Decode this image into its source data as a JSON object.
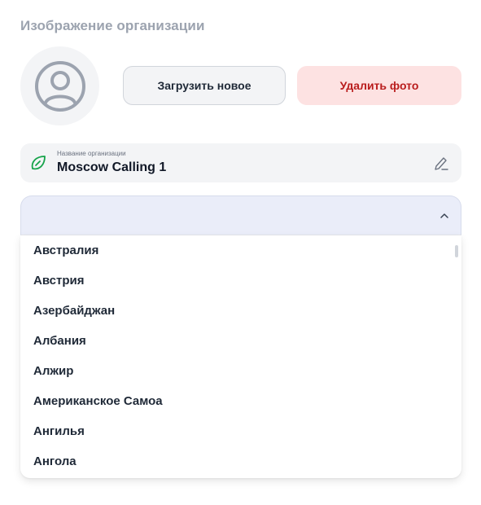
{
  "section_title": "Изображение организации",
  "avatar": {
    "icon": "user-circle-icon"
  },
  "buttons": {
    "upload_label": "Загрузить новое",
    "delete_label": "Удалить фото"
  },
  "org_name": {
    "label": "Название организации",
    "value": "Moscow Calling 1",
    "icon": "leaf-icon",
    "edit_icon": "pencil-icon"
  },
  "country_select": {
    "value": "",
    "open": true,
    "chevron_icon": "chevron-up-icon",
    "options": [
      "Австралия",
      "Австрия",
      "Азербайджан",
      "Албания",
      "Алжир",
      "Американское Самоа",
      "Ангилья",
      "Ангола"
    ]
  },
  "colors": {
    "title_gray": "#9ca3af",
    "delete_bg": "#fde2e2",
    "delete_text": "#b91c1c",
    "select_bg": "#eaedf9",
    "leaf_green": "#16a34a"
  }
}
